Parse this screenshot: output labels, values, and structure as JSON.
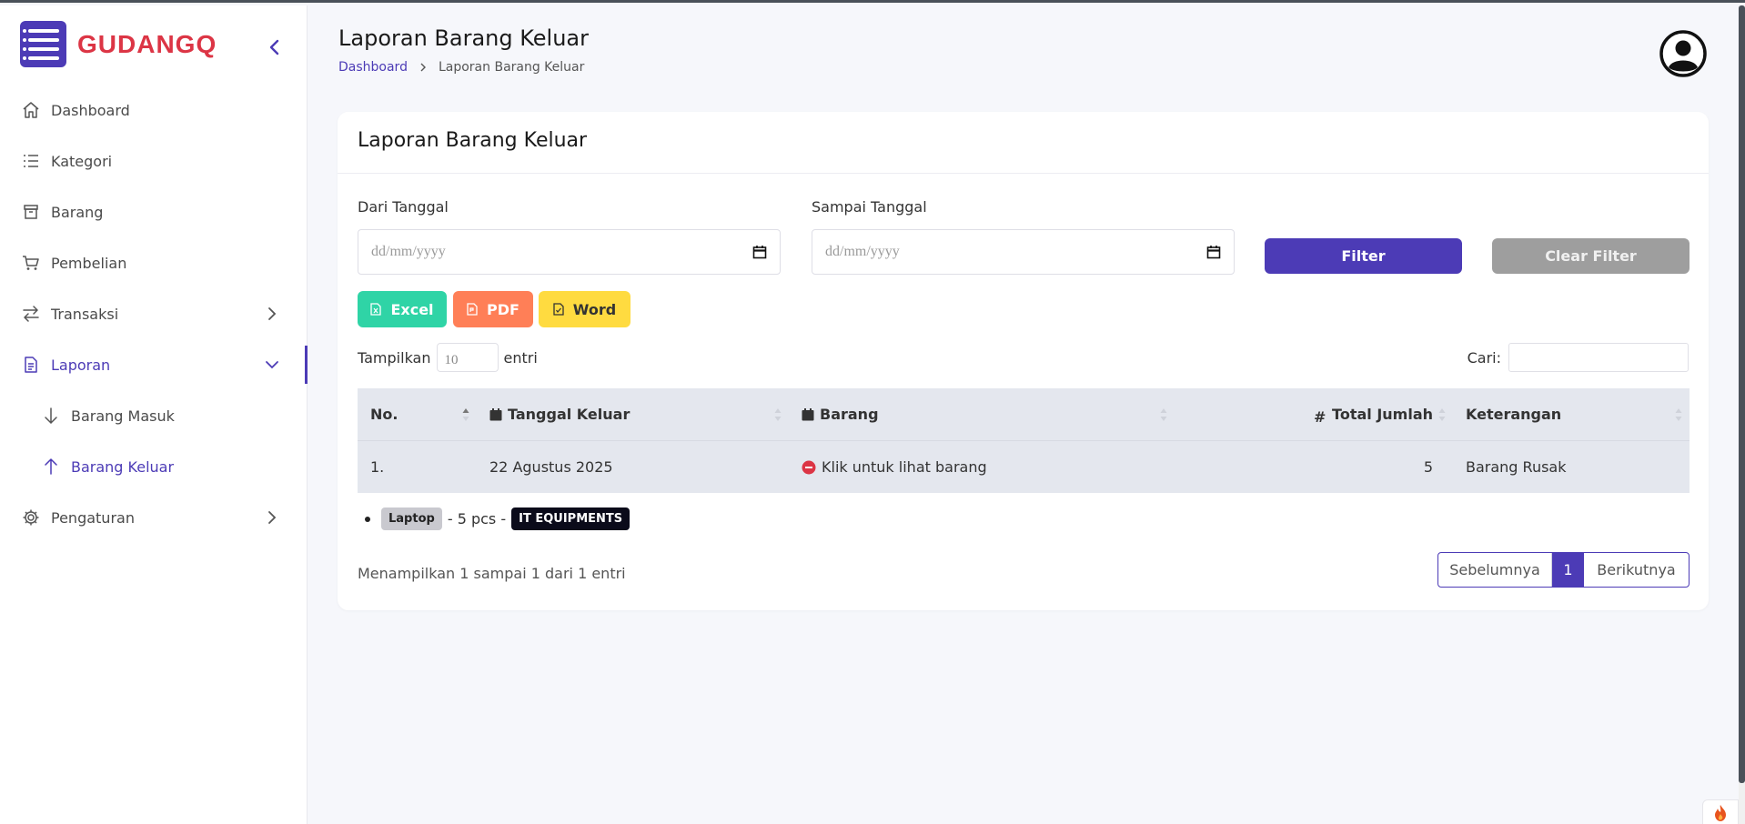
{
  "brand": {
    "name": "GUDANGQ"
  },
  "sidebar": {
    "items": [
      {
        "label": "Dashboard"
      },
      {
        "label": "Kategori"
      },
      {
        "label": "Barang"
      },
      {
        "label": "Pembelian"
      },
      {
        "label": "Transaksi"
      },
      {
        "label": "Laporan"
      },
      {
        "label": "Barang Masuk"
      },
      {
        "label": "Barang Keluar"
      },
      {
        "label": "Pengaturan"
      }
    ]
  },
  "header": {
    "title": "Laporan Barang Keluar",
    "breadcrumb": {
      "home": "Dashboard",
      "current": "Laporan Barang Keluar"
    }
  },
  "card": {
    "title": "Laporan Barang Keluar",
    "filter": {
      "from_label": "Dari Tanggal",
      "to_label": "Sampai Tanggal",
      "from_placeholder": "dd/mm/yyyy",
      "to_placeholder": "dd/mm/yyyy",
      "filter_button": "Filter",
      "clear_button": "Clear Filter"
    },
    "export": {
      "excel": "Excel",
      "pdf": "PDF",
      "word": "Word"
    },
    "length": {
      "prefix": "Tampilkan",
      "value": "10",
      "suffix": "entri"
    },
    "search": {
      "label": "Cari:"
    },
    "table": {
      "headers": [
        "No.",
        "Tanggal Keluar",
        "Barang",
        "Total Jumlah",
        "Keterangan"
      ],
      "rows": [
        {
          "no": "1.",
          "tanggal": "22 Agustus 2025",
          "barang": "Klik untuk lihat barang",
          "total": "5",
          "keterangan": "Barang Rusak"
        }
      ]
    },
    "detail": {
      "item": "Laptop",
      "qty_text": "- 5 pcs -",
      "category": "IT EQUIPMENTS"
    },
    "info": "Menampilkan 1 sampai 1 dari 1 entri",
    "pager": {
      "prev": "Sebelumnya",
      "page": "1",
      "next": "Berikutnya"
    }
  },
  "colors": {
    "primary": "#4c3bb6",
    "brand_text": "#dc3545",
    "excel": "#2fd4a6",
    "pdf": "#ff7f57",
    "word": "#ffdb40",
    "clear": "#9e9e9e"
  }
}
